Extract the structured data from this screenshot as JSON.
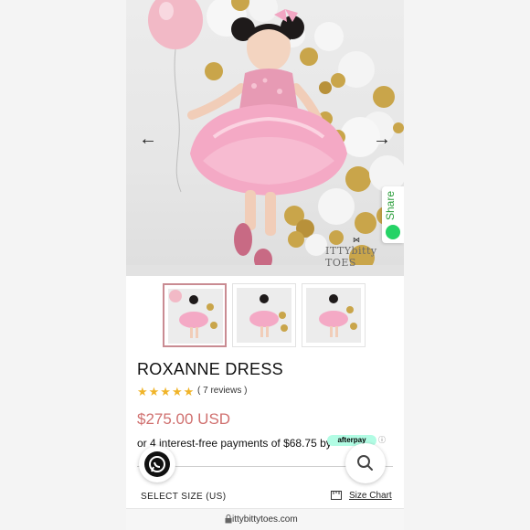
{
  "product": {
    "title": "ROXANNE DRESS",
    "rating_stars": "★★★★★",
    "reviews": "( 7 reviews )",
    "price": "$275.00 USD",
    "installments": "or 4 interest-free payments of $68.75 by",
    "afterpay_badge": "afterpay",
    "info_icon": "ⓘ"
  },
  "gallery": {
    "prev_arrow": "←",
    "next_arrow": "→",
    "share_label": "Share",
    "watermark": "ITTYbitty TOES",
    "bow": "⋈"
  },
  "size": {
    "label": "SELECT SIZE (US)",
    "chart_link": "Size Chart"
  },
  "browser": {
    "url": "ittybittytoes.com",
    "lock_icon": "🔒"
  },
  "colors": {
    "price": "#d0706f",
    "afterpay": "#b2fce4",
    "whatsapp": "#25d366",
    "stars": "#f0b429"
  }
}
